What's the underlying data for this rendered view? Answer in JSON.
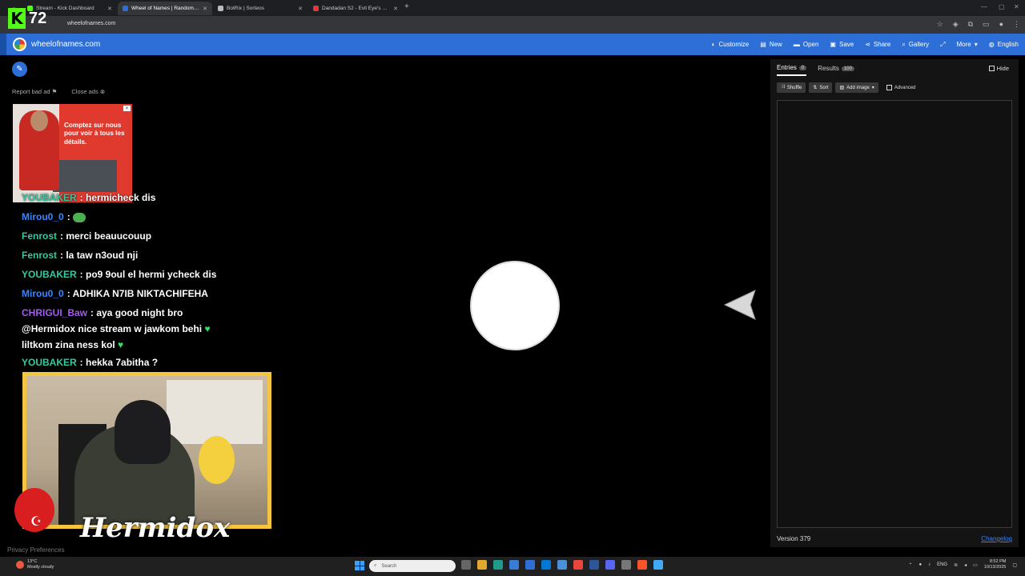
{
  "browser": {
    "tabs": [
      {
        "title": "Stream - Kick Dashboard",
        "active": false,
        "color": "#53fc18"
      },
      {
        "title": "Wheel of Names | Random nam",
        "active": true,
        "color": "#2d6fd6"
      },
      {
        "title": "BotRix | Sorteos",
        "active": false,
        "color": "#bbbbbb"
      },
      {
        "title": "Dandadan S2 - Evil Eye's exorci",
        "active": false,
        "color": "#e53935"
      }
    ],
    "url": "wheelofnames.com"
  },
  "overlay": {
    "kick_letter": "K",
    "viewer_count": "72"
  },
  "app": {
    "title": "wheelofnames.com",
    "menu": [
      {
        "label": "Customize",
        "icon": "palette-icon"
      },
      {
        "label": "New",
        "icon": "new-file-icon"
      },
      {
        "label": "Open",
        "icon": "folder-icon"
      },
      {
        "label": "Save",
        "icon": "save-icon"
      },
      {
        "label": "Share",
        "icon": "share-icon"
      },
      {
        "label": "Gallery",
        "icon": "search-icon"
      },
      {
        "label": "",
        "icon": "fullscreen-icon"
      },
      {
        "label": "More",
        "icon": "chevron-down-icon"
      },
      {
        "label": "English",
        "icon": "globe-icon"
      }
    ]
  },
  "ads": {
    "report_label": "Report bad ad",
    "close_label": "Close ads",
    "banner_text": "Comptez sur nous pour voir à tous les détails."
  },
  "chat": [
    {
      "user": "YOUBAKER",
      "color": "#37c9a0",
      "msg": ": hermicheck dis"
    },
    {
      "user": "Mirou0_0",
      "color": "#3a86ff",
      "msg": ":"
    },
    {
      "user": "Fenrost",
      "color": "#37c9a0",
      "msg": ": merci beauucouup"
    },
    {
      "user": "Fenrost",
      "color": "#37c9a0",
      "msg": ": la taw n3oud nji"
    },
    {
      "user": "YOUBAKER",
      "color": "#37c9a0",
      "msg": ": po9 9oul el hermi ycheck dis"
    },
    {
      "user": "Mirou0_0",
      "color": "#3a86ff",
      "msg": ": ADHIKA N7IB NIKTACHIFEHA"
    },
    {
      "user": "CHRIGUI_Baw",
      "color": "#a45bf0",
      "msg": ": aya good night bro"
    },
    {
      "user": "",
      "color": "#ffffff",
      "msg": "@Hermidox nice stream w jawkom behi"
    },
    {
      "user": "",
      "color": "#ffffff",
      "msg": "liltkom zina ness kol"
    },
    {
      "user": "YOUBAKER",
      "color": "#37c9a0",
      "msg": ": hekka 7abitha ?"
    }
  ],
  "streamer": {
    "name": "Hermidox"
  },
  "footer": {
    "privacy": "Privacy Preferences"
  },
  "panel": {
    "tabs": [
      {
        "label": "Entries",
        "count": "0",
        "active": true
      },
      {
        "label": "Results",
        "count": "100",
        "active": false
      }
    ],
    "hide_label": "Hide",
    "tools": [
      {
        "label": "Shuffle",
        "icon": "shuffle-icon"
      },
      {
        "label": "Sort",
        "icon": "sort-icon"
      },
      {
        "label": "Add image",
        "icon": "image-icon"
      }
    ],
    "advanced_label": "Advanced",
    "version": "Version 379",
    "changelog": "Changelog"
  },
  "taskbar": {
    "weather_temp": "13°C",
    "weather_desc": "Mostly cloudy",
    "search_placeholder": "Search",
    "lang": "ENG",
    "time": "8:52 PM",
    "date": "10/13/2025"
  }
}
